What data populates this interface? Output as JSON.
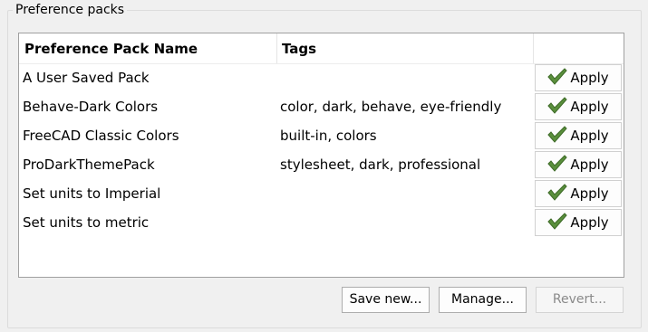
{
  "group": {
    "title": "Preference packs"
  },
  "table": {
    "headers": [
      "Preference Pack Name",
      "Tags",
      ""
    ],
    "rows": [
      {
        "name": "A User Saved Pack",
        "tags": "",
        "action": "Apply"
      },
      {
        "name": "Behave-Dark Colors",
        "tags": "color, dark, behave, eye-friendly",
        "action": "Apply"
      },
      {
        "name": "FreeCAD Classic Colors",
        "tags": "built-in, colors",
        "action": "Apply"
      },
      {
        "name": "ProDarkThemePack",
        "tags": "stylesheet, dark, professional",
        "action": "Apply"
      },
      {
        "name": "Set units to Imperial",
        "tags": "",
        "action": "Apply"
      },
      {
        "name": "Set units to metric",
        "tags": "",
        "action": "Apply"
      }
    ],
    "action_icon": "checkmark-icon"
  },
  "buttons": {
    "save_new": "Save new...",
    "manage": "Manage...",
    "revert": "Revert..."
  },
  "colors": {
    "check_fill": "#5a8f3c",
    "check_stroke": "#3d6a27"
  }
}
